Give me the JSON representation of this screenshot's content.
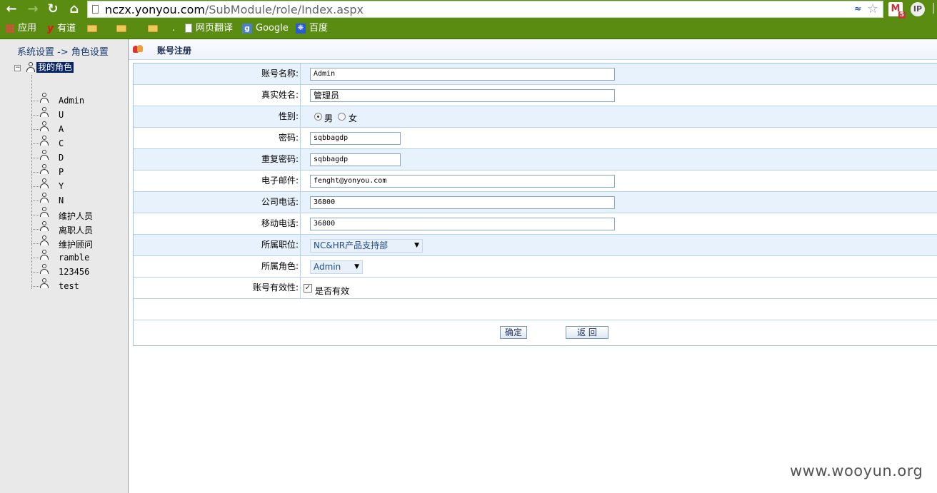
{
  "browser": {
    "url_host": "nczx.yonyou.com",
    "url_path": "/SubModule/role/Index.aspx",
    "gmail_badge": "5",
    "ip_ext": "IP",
    "bookmarks": {
      "apps": "应用",
      "youdao": "有道",
      "dot": ".",
      "translate": "网页翻译",
      "google": "Google",
      "baidu": "百度"
    }
  },
  "sidebar": {
    "breadcrumb": "系统设置 -> 角色设置",
    "root_label": "我的角色",
    "items": [
      "Admin",
      "U",
      "A",
      "C",
      "D",
      "P",
      "Y",
      "N",
      "维护人员",
      "离职人员",
      "维护顾问",
      "ramble",
      "123456",
      "test"
    ]
  },
  "page": {
    "title": "账号注册"
  },
  "form": {
    "account_name_label": "账号名称:",
    "account_name_value": "Admin",
    "real_name_label": "真实姓名:",
    "real_name_value": "管理员",
    "gender_label": "性别:",
    "gender_male": "男",
    "gender_female": "女",
    "gender_selected": "男",
    "password_label": "密码:",
    "password_value": "sqbbagdp",
    "repeat_password_label": "重复密码:",
    "repeat_password_value": "sqbbagdp",
    "email_label": "电子邮件:",
    "email_value": "fenght@yonyou.com",
    "office_phone_label": "公司电话:",
    "office_phone_value": "36800",
    "mobile_label": "移动电话:",
    "mobile_value": "36800",
    "position_label": "所属职位:",
    "position_value": "NC&HR产品支持部",
    "role_label": "所属角色:",
    "role_value": "Admin",
    "valid_label": "账号有效性:",
    "valid_checkbox_label": "是否有效",
    "valid_checked": true,
    "confirm_button": "确定",
    "back_button": "返 回"
  },
  "watermark": "www.wooyun.org",
  "colors": {
    "browser_green": "#5a8c12",
    "row_shade": "#e8f2fc",
    "selection": "#0a246a"
  }
}
